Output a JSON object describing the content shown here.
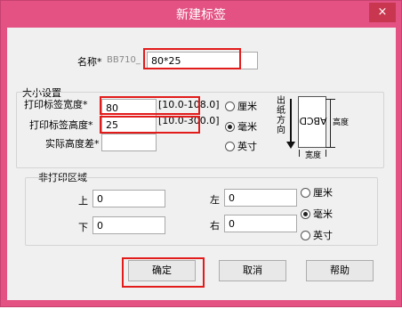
{
  "window": {
    "title": "新建标签",
    "close_glyph": "×"
  },
  "name_row": {
    "label": "名称*",
    "prefix": "BB710_",
    "value": "80*25"
  },
  "size_group": {
    "legend": "大小设置",
    "width_label": "打印标签宽度*",
    "width_value": "80",
    "width_range": "[10.0-108.0]",
    "height_label": "打印标签高度*",
    "height_value": "25",
    "height_range": "[10.0-300.0]",
    "actual_height_label": "实际高度差*",
    "actual_height_value": "",
    "units": [
      {
        "label": "厘米",
        "selected": false
      },
      {
        "label": "毫米",
        "selected": true
      },
      {
        "label": "英寸",
        "selected": false
      }
    ],
    "diagram": {
      "direction_label": "出纸方向",
      "sample_text": "ABCD",
      "height_label": "高度",
      "width_label": "宽度"
    }
  },
  "nonprint_group": {
    "legend": "非打印区域",
    "top_label": "上",
    "top_value": "0",
    "left_label": "左",
    "left_value": "0",
    "bottom_label": "下",
    "bottom_value": "0",
    "right_label": "右",
    "right_value": "0",
    "units": [
      {
        "label": "厘米",
        "selected": false
      },
      {
        "label": "毫米",
        "selected": true
      },
      {
        "label": "英寸",
        "selected": false
      }
    ]
  },
  "buttons": {
    "ok": "确定",
    "cancel": "取消",
    "help": "帮助"
  },
  "colors": {
    "title_bar": "#e35283",
    "highlight": "#e21b1b"
  }
}
